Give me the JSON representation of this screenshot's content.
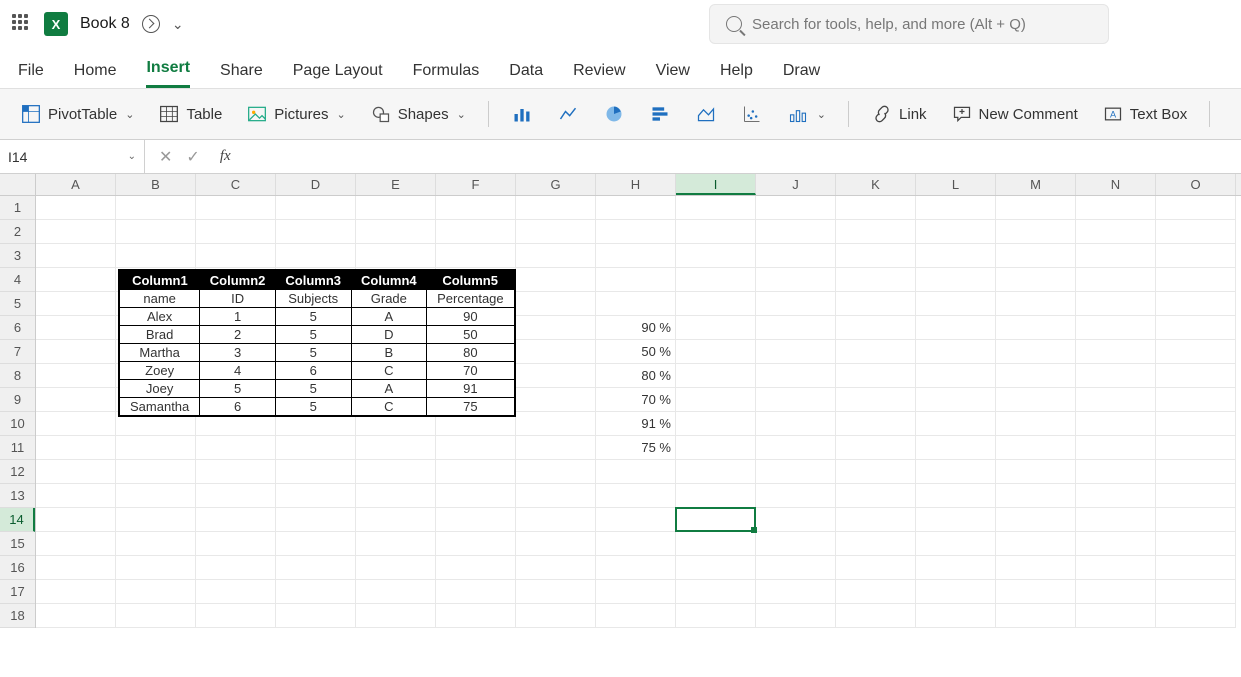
{
  "title_bar": {
    "doc_name": "Book 8"
  },
  "search": {
    "placeholder": "Search for tools, help, and more (Alt + Q)"
  },
  "tabs": [
    "File",
    "Home",
    "Insert",
    "Share",
    "Page Layout",
    "Formulas",
    "Data",
    "Review",
    "View",
    "Help",
    "Draw"
  ],
  "active_tab": "Insert",
  "ribbon": {
    "pivot": "PivotTable",
    "table": "Table",
    "pictures": "Pictures",
    "shapes": "Shapes",
    "link": "Link",
    "comment": "New Comment",
    "textbox": "Text Box"
  },
  "namebox": "I14",
  "columns": [
    "A",
    "B",
    "C",
    "D",
    "E",
    "F",
    "G",
    "H",
    "I",
    "J",
    "K",
    "L",
    "M",
    "N",
    "O"
  ],
  "selected_col": "I",
  "row_count": 18,
  "selected_row": 14,
  "embedded_table": {
    "headers": [
      "Column1",
      "Column2",
      "Column3",
      "Column4",
      "Column5"
    ],
    "labels": [
      "name",
      "ID",
      "Subjects",
      "Grade",
      "Percentage"
    ],
    "rows": [
      [
        "Alex",
        "1",
        "5",
        "A",
        "90"
      ],
      [
        "Brad",
        "2",
        "5",
        "D",
        "50"
      ],
      [
        "Martha",
        "3",
        "5",
        "B",
        "80"
      ],
      [
        "Zoey",
        "4",
        "6",
        "C",
        "70"
      ],
      [
        "Joey",
        "5",
        "5",
        "A",
        "91"
      ],
      [
        "Samantha",
        "6",
        "5",
        "C",
        "75"
      ]
    ]
  },
  "col_h_values": [
    "90 %",
    "50 %",
    "80 %",
    "70 %",
    "91 %",
    "75 %"
  ],
  "col_h_start_row": 6
}
